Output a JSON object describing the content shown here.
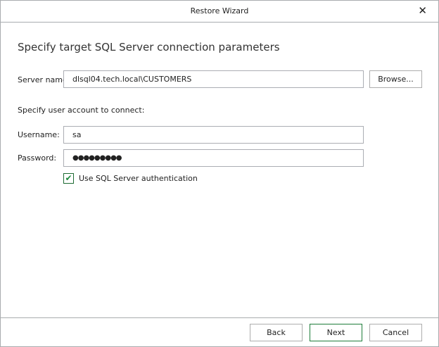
{
  "window": {
    "title": "Restore Wizard"
  },
  "heading": "Specify target SQL Server connection parameters",
  "server": {
    "label": "Server name:",
    "value": "dlsql04.tech.local\\CUSTOMERS",
    "browse_label": "Browse..."
  },
  "account_prompt": "Specify user account to connect:",
  "username": {
    "label": "Username:",
    "value": "sa"
  },
  "password": {
    "label": "Password:",
    "value": "●●●●●●●●●"
  },
  "sql_auth": {
    "label": "Use SQL Server authentication",
    "checked": true
  },
  "footer": {
    "back": "Back",
    "next": "Next",
    "cancel": "Cancel"
  },
  "colors": {
    "accent": "#1e7d3a",
    "border": "#a9acaf"
  }
}
